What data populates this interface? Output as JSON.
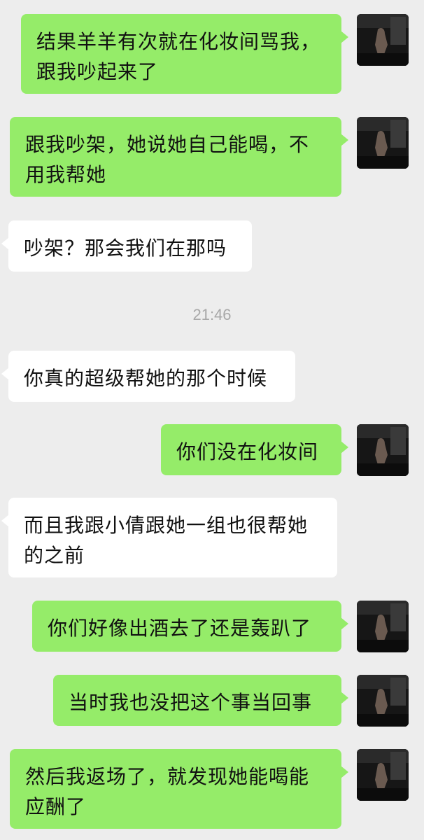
{
  "messages": [
    {
      "side": "sent",
      "text": "结果羊羊有次就在化妆间骂我，跟我吵起来了"
    },
    {
      "side": "sent",
      "text": "跟我吵架，她说她自己能喝，不用我帮她"
    },
    {
      "side": "received",
      "text": "吵架？那会我们在那吗"
    },
    {
      "side": "time",
      "text": "21:46"
    },
    {
      "side": "received",
      "text": "你真的超级帮她的那个时候"
    },
    {
      "side": "sent",
      "text": "你们没在化妆间"
    },
    {
      "side": "received",
      "text": "而且我跟小倩跟她一组也很帮她的之前"
    },
    {
      "side": "sent",
      "text": "你们好像出酒去了还是轰趴了"
    },
    {
      "side": "sent",
      "text": "当时我也没把这个事当回事"
    },
    {
      "side": "sent",
      "text": "然后我返场了，就发现她能喝能应酬了"
    }
  ],
  "colors": {
    "background": "#ededed",
    "sent_bubble": "#95ec69",
    "received_bubble": "#ffffff",
    "timestamp_text": "#a8a8a8"
  },
  "icons": {
    "avatar": "user-avatar-photo"
  }
}
